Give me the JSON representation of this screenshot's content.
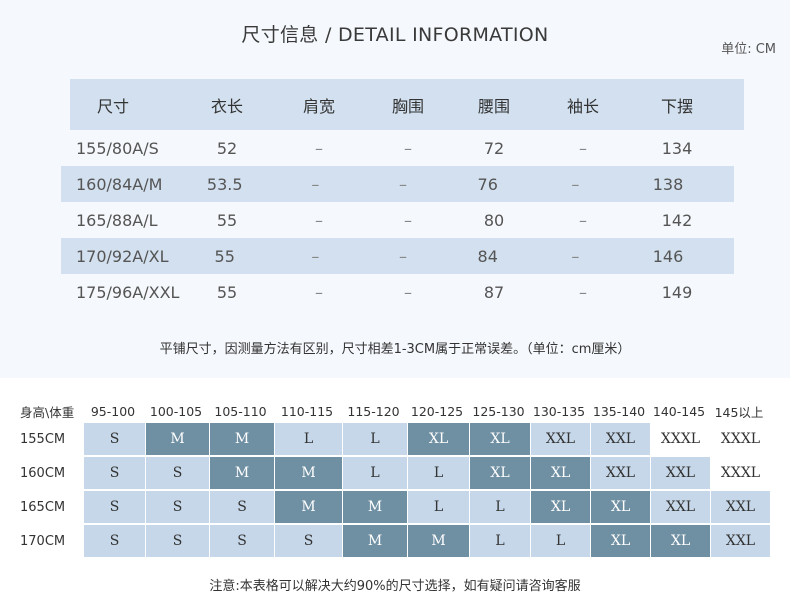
{
  "header": {
    "title": "尺寸信息 / DETAIL INFORMATION",
    "unit": "单位: CM"
  },
  "size_table": {
    "columns": [
      "尺寸",
      "衣长",
      "肩宽",
      "胸围",
      "腰围",
      "袖长",
      "下摆"
    ],
    "rows": [
      [
        "155/80A/S",
        "52",
        "–",
        "–",
        "72",
        "–",
        "134"
      ],
      [
        "160/84A/M",
        "53.5",
        "–",
        "–",
        "76",
        "–",
        "138"
      ],
      [
        "165/88A/L",
        "55",
        "–",
        "–",
        "80",
        "–",
        "142"
      ],
      [
        "170/92A/XL",
        "55",
        "–",
        "–",
        "84",
        "–",
        "146"
      ],
      [
        "175/96A/XXL",
        "55",
        "–",
        "–",
        "87",
        "–",
        "149"
      ]
    ]
  },
  "note_top": "平铺尺寸，因测量方法有区别，尺寸相差1-3CM属于正常误差。（单位：cm厘米）",
  "weight_grid": {
    "corner": "身高\\体重",
    "columns": [
      "95-100",
      "100-105",
      "105-110",
      "110-115",
      "115-120",
      "120-125",
      "125-130",
      "130-135",
      "135-140",
      "140-145",
      "145以上"
    ],
    "rows": [
      {
        "label": "155CM",
        "cells": [
          {
            "v": "S",
            "s": "light"
          },
          {
            "v": "M",
            "s": "dark"
          },
          {
            "v": "M",
            "s": "dark"
          },
          {
            "v": "L",
            "s": "light"
          },
          {
            "v": "L",
            "s": "light"
          },
          {
            "v": "XL",
            "s": "dark"
          },
          {
            "v": "XL",
            "s": "dark"
          },
          {
            "v": "XXL",
            "s": "light"
          },
          {
            "v": "XXL",
            "s": "light"
          },
          {
            "v": "XXXL",
            "s": "white"
          },
          {
            "v": "XXXL",
            "s": "white"
          }
        ]
      },
      {
        "label": "160CM",
        "cells": [
          {
            "v": "S",
            "s": "light"
          },
          {
            "v": "S",
            "s": "light"
          },
          {
            "v": "M",
            "s": "dark"
          },
          {
            "v": "M",
            "s": "dark"
          },
          {
            "v": "L",
            "s": "light"
          },
          {
            "v": "L",
            "s": "light"
          },
          {
            "v": "XL",
            "s": "dark"
          },
          {
            "v": "XL",
            "s": "dark"
          },
          {
            "v": "XXL",
            "s": "light"
          },
          {
            "v": "XXL",
            "s": "light"
          },
          {
            "v": "XXXL",
            "s": "white"
          }
        ]
      },
      {
        "label": "165CM",
        "cells": [
          {
            "v": "S",
            "s": "light"
          },
          {
            "v": "S",
            "s": "light"
          },
          {
            "v": "S",
            "s": "light"
          },
          {
            "v": "M",
            "s": "dark"
          },
          {
            "v": "M",
            "s": "dark"
          },
          {
            "v": "L",
            "s": "light"
          },
          {
            "v": "L",
            "s": "light"
          },
          {
            "v": "XL",
            "s": "dark"
          },
          {
            "v": "XL",
            "s": "dark"
          },
          {
            "v": "XXL",
            "s": "light"
          },
          {
            "v": "XXL",
            "s": "light"
          }
        ]
      },
      {
        "label": "170CM",
        "cells": [
          {
            "v": "S",
            "s": "light"
          },
          {
            "v": "S",
            "s": "light"
          },
          {
            "v": "S",
            "s": "light"
          },
          {
            "v": "S",
            "s": "light"
          },
          {
            "v": "M",
            "s": "dark"
          },
          {
            "v": "M",
            "s": "dark"
          },
          {
            "v": "L",
            "s": "light"
          },
          {
            "v": "L",
            "s": "light"
          },
          {
            "v": "XL",
            "s": "dark"
          },
          {
            "v": "XL",
            "s": "dark"
          },
          {
            "v": "XXL",
            "s": "light"
          }
        ]
      }
    ]
  },
  "note_bottom": "注意:本表格可以解决大约90%的尺寸选择，如有疑问请咨询客服",
  "colors": {
    "panel_bg": "#f5f8fc",
    "band": "#d2e0ef",
    "cell_light": "#c5d7e8",
    "cell_dark": "#6f8fa2"
  }
}
